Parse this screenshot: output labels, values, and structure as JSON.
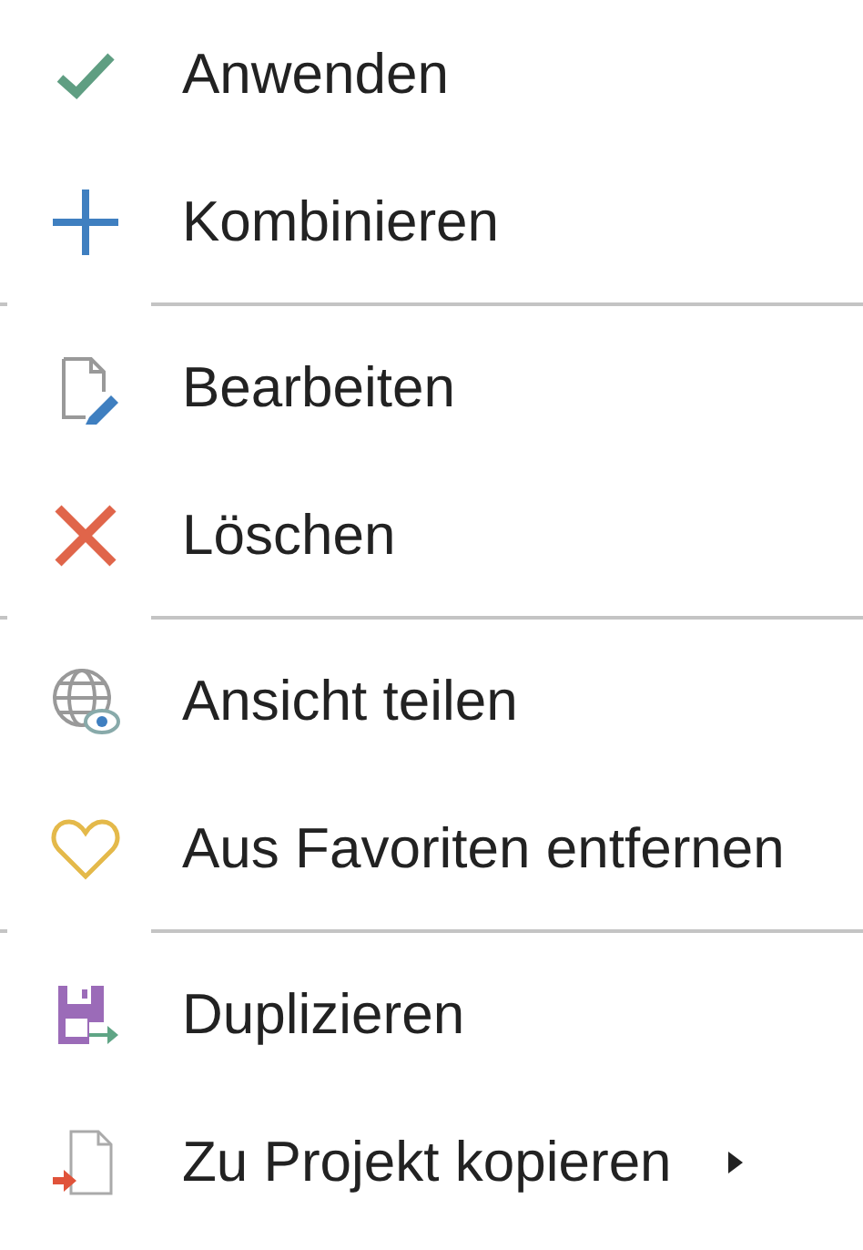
{
  "menu": {
    "groups": [
      {
        "items": [
          {
            "kind": "apply",
            "label": "Anwenden",
            "submenu": false
          },
          {
            "kind": "combine",
            "label": "Kombinieren",
            "submenu": false
          }
        ]
      },
      {
        "items": [
          {
            "kind": "edit",
            "label": "Bearbeiten",
            "submenu": false
          },
          {
            "kind": "delete",
            "label": "Löschen",
            "submenu": false
          }
        ]
      },
      {
        "items": [
          {
            "kind": "share",
            "label": "Ansicht teilen",
            "submenu": false
          },
          {
            "kind": "unfavorite",
            "label": "Aus Favoriten entfernen",
            "submenu": false
          }
        ]
      },
      {
        "items": [
          {
            "kind": "duplicate",
            "label": "Duplizieren",
            "submenu": false
          },
          {
            "kind": "copy",
            "label": "Zu Projekt kopieren",
            "submenu": true
          }
        ]
      }
    ]
  }
}
